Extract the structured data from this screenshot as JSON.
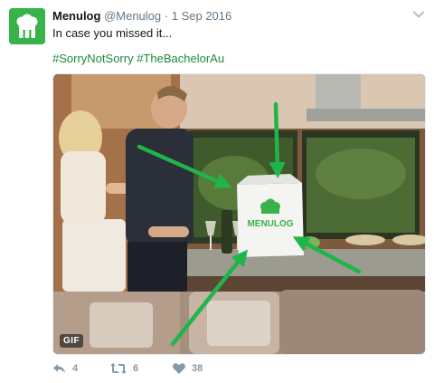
{
  "tweet": {
    "author_name": "Menulog",
    "author_handle": "@Menulog",
    "separator": "·",
    "date": "1 Sep 2016",
    "text": "In case you missed it...",
    "hashtags": [
      "#SorryNotSorry",
      "#TheBachelorAu"
    ],
    "media": {
      "badge": "GIF",
      "bag_logo_text": "MENULOG"
    },
    "actions": {
      "reply_count": "4",
      "retweet_count": "6",
      "like_count": "38"
    }
  },
  "colors": {
    "brand_green": "#37b34a",
    "hashtag_green": "#1e8a3b",
    "meta_gray": "#657786",
    "action_gray": "#8899a6"
  },
  "icons": [
    "menulog-logo-icon",
    "chevron-down-icon",
    "reply-icon",
    "retweet-icon",
    "heart-icon"
  ]
}
